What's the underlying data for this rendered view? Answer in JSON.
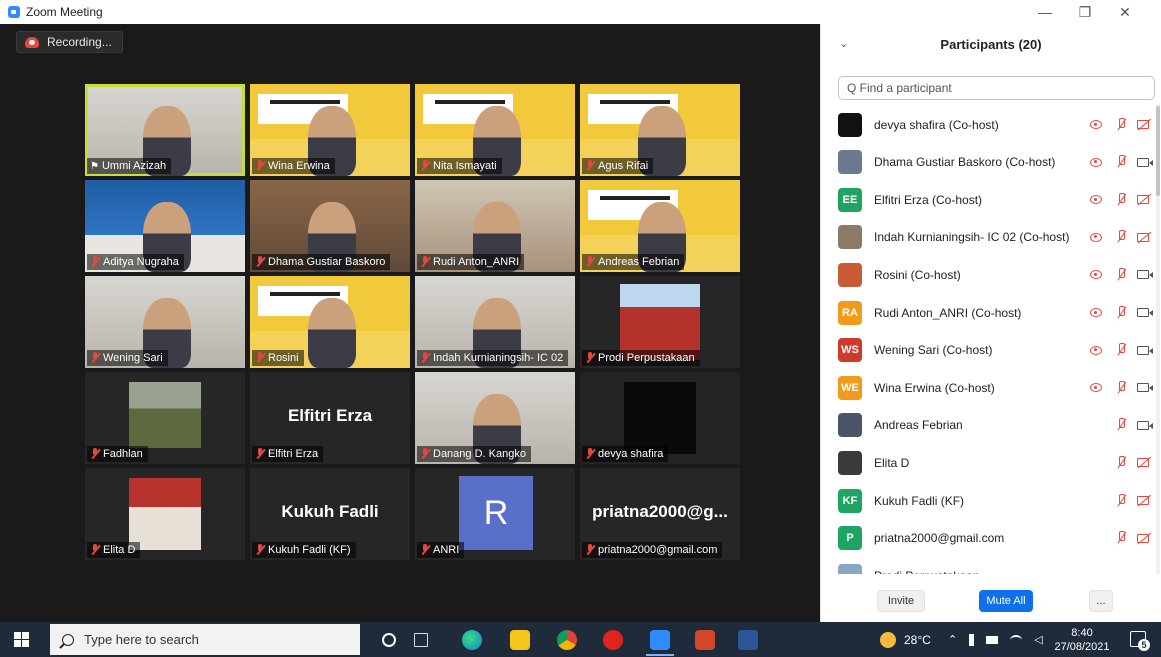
{
  "window": {
    "title": "Zoom Meeting"
  },
  "recording": {
    "label": "Recording..."
  },
  "gallery": [
    {
      "name": "Ummi Azizah",
      "pinned": true,
      "active": true,
      "style": "room-light"
    },
    {
      "name": "Wina Erwina",
      "style": "banner"
    },
    {
      "name": "Nita Ismayati",
      "style": "banner"
    },
    {
      "name": "Agus Rifai",
      "style": "banner"
    },
    {
      "name": "Aditya Nugraha",
      "style": "room-blue"
    },
    {
      "name": "Dhama Gustiar Baskoro",
      "style": "room-brown"
    },
    {
      "name": "Rudi Anton_ANRI",
      "style": "room-office"
    },
    {
      "name": "Andreas Febrian",
      "style": "banner"
    },
    {
      "name": "Wening Sari",
      "style": "room-light"
    },
    {
      "name": "Rosini",
      "style": "banner"
    },
    {
      "name": "Indah Kurnianingsih- IC 02",
      "style": "room-light"
    },
    {
      "name": "Prodi Perpustakaan",
      "style": "building"
    },
    {
      "name": "Fadhlan",
      "style": "landscape"
    },
    {
      "name": "Elfitri Erza",
      "big": "Elfitri Erza",
      "style": "text"
    },
    {
      "name": "Danang D. Kangko",
      "style": "room-light"
    },
    {
      "name": "devya shafira",
      "style": "dark"
    },
    {
      "name": "Elita D",
      "style": "photo"
    },
    {
      "name": "Kukuh Fadli (KF)",
      "big": "Kukuh Fadli",
      "style": "text"
    },
    {
      "name": "ANRI",
      "avatar": "R",
      "style": "avatar"
    },
    {
      "name": "priatna2000@gmail.com",
      "big": "priatna2000@g...",
      "style": "text"
    }
  ],
  "panel": {
    "title": "Participants (20)",
    "search_placeholder": "Q Find a participant",
    "participants": [
      {
        "name": "devya shafira (Co-host)",
        "avatar": "",
        "color": "#111111",
        "video": "off",
        "raise": true
      },
      {
        "name": "Dhama Gustiar Baskoro (Co-host)",
        "avatar": "",
        "color": "#6b7a8e",
        "video": "on",
        "raise": true
      },
      {
        "name": "Elfitri Erza (Co-host)",
        "avatar": "EE",
        "color": "#1fa463",
        "video": "off",
        "raise": true
      },
      {
        "name": "Indah Kurnianingsih- IC 02 (Co-host)",
        "avatar": "",
        "color": "#8a7a66",
        "video": "off",
        "raise": true
      },
      {
        "name": "Rosini (Co-host)",
        "avatar": "",
        "color": "#c85a36",
        "video": "on",
        "raise": true
      },
      {
        "name": "Rudi Anton_ANRI (Co-host)",
        "avatar": "RA",
        "color": "#f29a1a",
        "video": "on",
        "raise": true
      },
      {
        "name": "Wening Sari (Co-host)",
        "avatar": "WS",
        "color": "#d03a2c",
        "video": "on",
        "raise": true
      },
      {
        "name": "Wina Erwina (Co-host)",
        "avatar": "WE",
        "color": "#f29a1a",
        "video": "on",
        "raise": true
      },
      {
        "name": "Andreas Febrian",
        "avatar": "",
        "color": "#4a5568",
        "video": "on",
        "raise": false
      },
      {
        "name": "Elita D",
        "avatar": "",
        "color": "#3b3b3b",
        "video": "off",
        "raise": false
      },
      {
        "name": "Kukuh Fadli (KF)",
        "avatar": "KF",
        "color": "#1fa463",
        "video": "off",
        "raise": false
      },
      {
        "name": "priatna2000@gmail.com",
        "avatar": "P",
        "color": "#1fa463",
        "video": "off",
        "raise": false
      }
    ],
    "partial_row": {
      "name": "Prodi Perpustakaan"
    },
    "invite": "Invite",
    "mute_all": "Mute All",
    "more": "..."
  },
  "taskbar": {
    "search_placeholder": "Type here to search",
    "weather": "28°C",
    "time": "8:40",
    "date": "27/08/2021",
    "notifications": "5"
  }
}
